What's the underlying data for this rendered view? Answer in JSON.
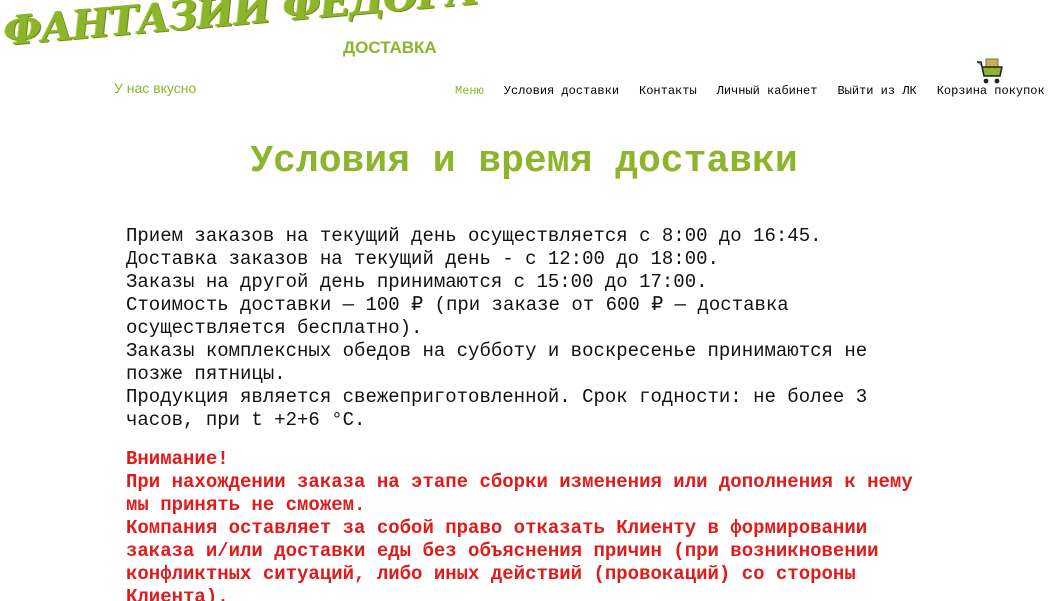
{
  "header": {
    "logo_title": "ФАНТАЗИИ ФЕДОРА",
    "logo_tagline": "У нас вкусно",
    "site_subtitle": "ДОСТАВКА",
    "cart_icon": "cart-icon",
    "brand_color": "#8db52b"
  },
  "nav": {
    "items": [
      {
        "label": "Меню",
        "active": true
      },
      {
        "label": "Условия доставки",
        "active": false
      },
      {
        "label": "Контакты",
        "active": false
      },
      {
        "label": "Личный кабинет",
        "active": false
      },
      {
        "label": "Выйти из ЛК",
        "active": false
      },
      {
        "label": "Корзина покупок",
        "active": false
      }
    ]
  },
  "page": {
    "title": "Условия и время доставки",
    "paragraphs": [
      "Прием заказов на текущий день осуществляется с 8:00 до 16:45.",
      "Доставка заказов на текущий день - с 12:00 до 18:00.",
      "Заказы на другой день принимаются с 15:00 до 17:00.",
      "Стоимость доставки — 100 ₽ (при заказе от 600 ₽ — доставка осуществляется бесплатно).",
      "Заказы комплексных обедов на субботу и воскресенье принимаются не позже пятницы.",
      "Продукция является свежеприготовленной. Срок годности: не более 3 часов, при t +2+6 °С."
    ],
    "warning": {
      "heading": "Внимание!",
      "lines": [
        "При нахождении заказа на этапе сборки изменения или дополнения к нему мы принять не сможем.",
        "Компания оставляет за собой право отказать Клиенту в формировании заказа и/или доставки еды без объяснения причин (при возникновении конфликтных ситуаций, либо иных действий (провокаций) со стороны Клиента)."
      ],
      "color": "#e01b1b"
    }
  }
}
